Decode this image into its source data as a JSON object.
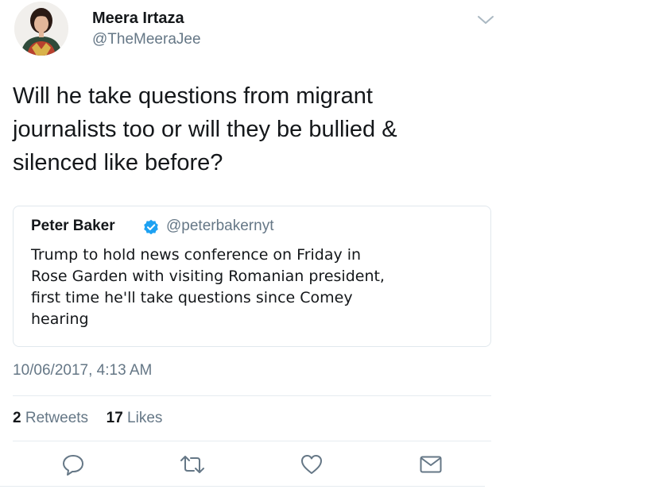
{
  "author": {
    "display_name": "Meera Irtaza",
    "handle": "@TheMeeraJee",
    "avatar": "profile-photo"
  },
  "menu": {
    "icon": "chevron-down-icon"
  },
  "tweet": {
    "text_lines": [
      "Will he take questions from migrant",
      "journalists too or will they be bullied &",
      "silenced like before?"
    ]
  },
  "quoted_tweet": {
    "author_name": "Peter Baker",
    "verified_icon": "verified-badge-icon",
    "handle": "@peterbakernyt",
    "text_lines": [
      "Trump to hold news conference on Friday in",
      "Rose Garden with visiting Romanian president,",
      "first time he'll take questions since Comey",
      "hearing"
    ]
  },
  "timestamp": "10/06/2017, 4:13 AM",
  "stats": {
    "retweets_count": "2",
    "retweets_label": "Retweets",
    "likes_count": "17",
    "likes_label": "Likes"
  },
  "actions": [
    {
      "name": "reply",
      "icon": "reply-icon"
    },
    {
      "name": "retweet",
      "icon": "retweet-icon"
    },
    {
      "name": "like",
      "icon": "heart-icon"
    },
    {
      "name": "direct-message",
      "icon": "envelope-icon"
    }
  ],
  "colors": {
    "text": "#14171a",
    "secondary": "#657786",
    "border": "#e1e8ed",
    "verified": "#1da1f2"
  }
}
